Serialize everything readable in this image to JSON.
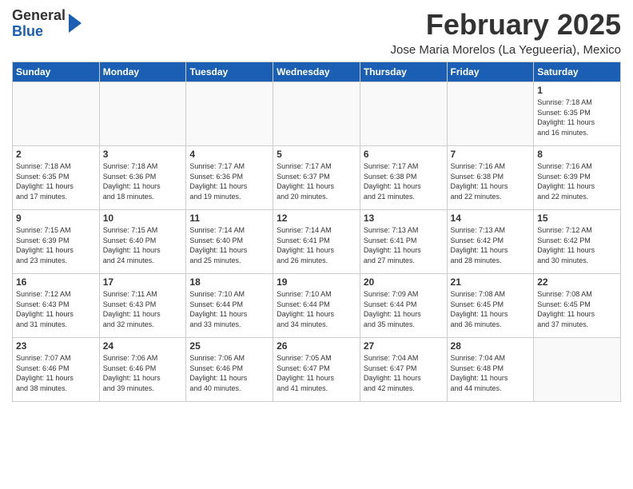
{
  "logo": {
    "general": "General",
    "blue": "Blue"
  },
  "title": "February 2025",
  "location": "Jose Maria Morelos (La Yegueeria), Mexico",
  "days_of_week": [
    "Sunday",
    "Monday",
    "Tuesday",
    "Wednesday",
    "Thursday",
    "Friday",
    "Saturday"
  ],
  "weeks": [
    [
      {
        "day": "",
        "info": ""
      },
      {
        "day": "",
        "info": ""
      },
      {
        "day": "",
        "info": ""
      },
      {
        "day": "",
        "info": ""
      },
      {
        "day": "",
        "info": ""
      },
      {
        "day": "",
        "info": ""
      },
      {
        "day": "1",
        "info": "Sunrise: 7:18 AM\nSunset: 6:35 PM\nDaylight: 11 hours\nand 16 minutes."
      }
    ],
    [
      {
        "day": "2",
        "info": "Sunrise: 7:18 AM\nSunset: 6:35 PM\nDaylight: 11 hours\nand 17 minutes."
      },
      {
        "day": "3",
        "info": "Sunrise: 7:18 AM\nSunset: 6:36 PM\nDaylight: 11 hours\nand 18 minutes."
      },
      {
        "day": "4",
        "info": "Sunrise: 7:17 AM\nSunset: 6:36 PM\nDaylight: 11 hours\nand 19 minutes."
      },
      {
        "day": "5",
        "info": "Sunrise: 7:17 AM\nSunset: 6:37 PM\nDaylight: 11 hours\nand 20 minutes."
      },
      {
        "day": "6",
        "info": "Sunrise: 7:17 AM\nSunset: 6:38 PM\nDaylight: 11 hours\nand 21 minutes."
      },
      {
        "day": "7",
        "info": "Sunrise: 7:16 AM\nSunset: 6:38 PM\nDaylight: 11 hours\nand 22 minutes."
      },
      {
        "day": "8",
        "info": "Sunrise: 7:16 AM\nSunset: 6:39 PM\nDaylight: 11 hours\nand 22 minutes."
      }
    ],
    [
      {
        "day": "9",
        "info": "Sunrise: 7:15 AM\nSunset: 6:39 PM\nDaylight: 11 hours\nand 23 minutes."
      },
      {
        "day": "10",
        "info": "Sunrise: 7:15 AM\nSunset: 6:40 PM\nDaylight: 11 hours\nand 24 minutes."
      },
      {
        "day": "11",
        "info": "Sunrise: 7:14 AM\nSunset: 6:40 PM\nDaylight: 11 hours\nand 25 minutes."
      },
      {
        "day": "12",
        "info": "Sunrise: 7:14 AM\nSunset: 6:41 PM\nDaylight: 11 hours\nand 26 minutes."
      },
      {
        "day": "13",
        "info": "Sunrise: 7:13 AM\nSunset: 6:41 PM\nDaylight: 11 hours\nand 27 minutes."
      },
      {
        "day": "14",
        "info": "Sunrise: 7:13 AM\nSunset: 6:42 PM\nDaylight: 11 hours\nand 28 minutes."
      },
      {
        "day": "15",
        "info": "Sunrise: 7:12 AM\nSunset: 6:42 PM\nDaylight: 11 hours\nand 30 minutes."
      }
    ],
    [
      {
        "day": "16",
        "info": "Sunrise: 7:12 AM\nSunset: 6:43 PM\nDaylight: 11 hours\nand 31 minutes."
      },
      {
        "day": "17",
        "info": "Sunrise: 7:11 AM\nSunset: 6:43 PM\nDaylight: 11 hours\nand 32 minutes."
      },
      {
        "day": "18",
        "info": "Sunrise: 7:10 AM\nSunset: 6:44 PM\nDaylight: 11 hours\nand 33 minutes."
      },
      {
        "day": "19",
        "info": "Sunrise: 7:10 AM\nSunset: 6:44 PM\nDaylight: 11 hours\nand 34 minutes."
      },
      {
        "day": "20",
        "info": "Sunrise: 7:09 AM\nSunset: 6:44 PM\nDaylight: 11 hours\nand 35 minutes."
      },
      {
        "day": "21",
        "info": "Sunrise: 7:08 AM\nSunset: 6:45 PM\nDaylight: 11 hours\nand 36 minutes."
      },
      {
        "day": "22",
        "info": "Sunrise: 7:08 AM\nSunset: 6:45 PM\nDaylight: 11 hours\nand 37 minutes."
      }
    ],
    [
      {
        "day": "23",
        "info": "Sunrise: 7:07 AM\nSunset: 6:46 PM\nDaylight: 11 hours\nand 38 minutes."
      },
      {
        "day": "24",
        "info": "Sunrise: 7:06 AM\nSunset: 6:46 PM\nDaylight: 11 hours\nand 39 minutes."
      },
      {
        "day": "25",
        "info": "Sunrise: 7:06 AM\nSunset: 6:46 PM\nDaylight: 11 hours\nand 40 minutes."
      },
      {
        "day": "26",
        "info": "Sunrise: 7:05 AM\nSunset: 6:47 PM\nDaylight: 11 hours\nand 41 minutes."
      },
      {
        "day": "27",
        "info": "Sunrise: 7:04 AM\nSunset: 6:47 PM\nDaylight: 11 hours\nand 42 minutes."
      },
      {
        "day": "28",
        "info": "Sunrise: 7:04 AM\nSunset: 6:48 PM\nDaylight: 11 hours\nand 44 minutes."
      },
      {
        "day": "",
        "info": ""
      }
    ]
  ]
}
